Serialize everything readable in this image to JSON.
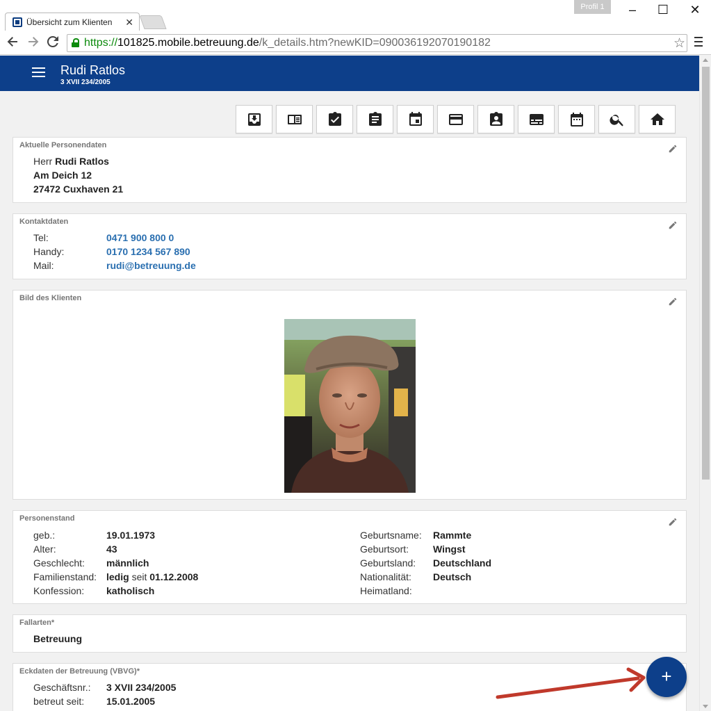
{
  "browser": {
    "tab_title": "Übersicht zum Klienten",
    "tab_close": "✕",
    "profile_label": "Profil 1",
    "window_minimize": "–",
    "window_maximize": "☐",
    "window_close": "✕",
    "url_scheme": "https://",
    "url_host": "101825.mobile.betreuung.de",
    "url_path": "/k_details.htm?newKID=090036192070190182",
    "icons": [
      "back-icon",
      "forward-icon",
      "reload-icon",
      "lock-icon",
      "star-icon",
      "menu-icon"
    ]
  },
  "appbar": {
    "name": "Rudi Ratlos",
    "case_number": "3 XVII 234/2005",
    "color": "#0d3f8a"
  },
  "actions": [
    {
      "icon": "inbox-download-icon"
    },
    {
      "icon": "book-icon"
    },
    {
      "icon": "checkbox-icon"
    },
    {
      "icon": "clipboard-icon"
    },
    {
      "icon": "calendar-event-icon"
    },
    {
      "icon": "credit-card-icon"
    },
    {
      "icon": "contact-badge-icon"
    },
    {
      "icon": "subtitles-icon"
    },
    {
      "icon": "calendar-icon"
    },
    {
      "icon": "search-icon"
    },
    {
      "icon": "home-icon"
    }
  ],
  "personal": {
    "title": "Aktuelle Personendaten",
    "salutation": "Herr",
    "name": "Rudi Ratlos",
    "street": "Am Deich 12",
    "city": "27472 Cuxhaven 21"
  },
  "contact": {
    "title": "Kontaktdaten",
    "tel_label": "Tel:",
    "tel": "0471 900 800 0",
    "mobile_label": "Handy:",
    "mobile": "0170 1234 567 890",
    "mail_label": "Mail:",
    "mail": "rudi@betreuung.de",
    "link_color": "#2a6fb0"
  },
  "photo": {
    "title": "Bild des Klienten"
  },
  "civil": {
    "title": "Personenstand",
    "born_label": "geb.:",
    "born": "19.01.1973",
    "age_label": "Alter:",
    "age": "43",
    "gender_label": "Geschlecht:",
    "gender": "männlich",
    "marital_label": "Familienstand:",
    "marital": "ledig",
    "marital_since_word": "seit",
    "marital_since": "01.12.2008",
    "religion_label": "Konfession:",
    "religion": "katholisch",
    "birthname_label": "Geburtsname:",
    "birthname": "Rammte",
    "birthplace_label": "Geburtsort:",
    "birthplace": "Wingst",
    "birthcountry_label": "Geburtsland:",
    "birthcountry": "Deutschland",
    "nationality_label": "Nationalität:",
    "nationality": "Deutsch",
    "homeland_label": "Heimatland:",
    "homeland": ""
  },
  "case_types": {
    "title": "Fallarten*",
    "value": "Betreuung"
  },
  "care_data": {
    "title": "Eckdaten der Betreuung (VBVG)*",
    "number_label": "Geschäftsnr.:",
    "number": "3 XVII 234/2005",
    "since_label": "betreut seit:",
    "since": "15.01.2005"
  },
  "fab": {
    "label": "+"
  },
  "annotation_arrow_color": "#c0392b"
}
